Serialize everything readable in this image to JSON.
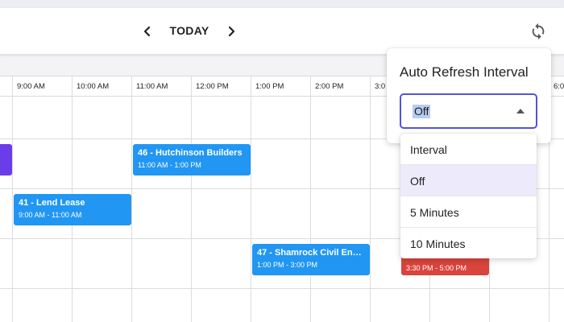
{
  "toolbar": {
    "today_label": "TODAY",
    "prev_icon": "chevron-left-icon",
    "next_icon": "chevron-right-icon",
    "refresh_icon": "refresh-icon"
  },
  "calendar": {
    "time_slots": [
      "9:00 AM",
      "10:00 AM",
      "11:00 AM",
      "12:00 PM",
      "1:00 PM",
      "2:00 PM",
      "3:0",
      "6:0"
    ],
    "events": [
      {
        "title": "46 - Hutchinson Builders",
        "time": "11:00 AM - 1:00 PM",
        "color": "#2196f3"
      },
      {
        "title": "41 - Lend Lease",
        "time": "9:00 AM - 11:00 AM",
        "color": "#2196f3"
      },
      {
        "title": "47 - Shamrock Civil Engineering",
        "time": "1:00 PM - 3:00 PM",
        "color": "#2196f3"
      },
      {
        "title": "",
        "time": "3:30 PM - 5:00 PM",
        "color": "#d9443c"
      },
      {
        "title": "",
        "time": "",
        "color": "#6a3de8"
      }
    ]
  },
  "auto_refresh": {
    "title": "Auto Refresh Interval",
    "selected": "Off",
    "options": [
      "Interval",
      "Off",
      "5 Minutes",
      "10 Minutes"
    ]
  },
  "colors": {
    "accent": "#5352d8",
    "event_blue": "#2196f3",
    "event_red": "#d9443c",
    "event_purple": "#6a3de8"
  }
}
